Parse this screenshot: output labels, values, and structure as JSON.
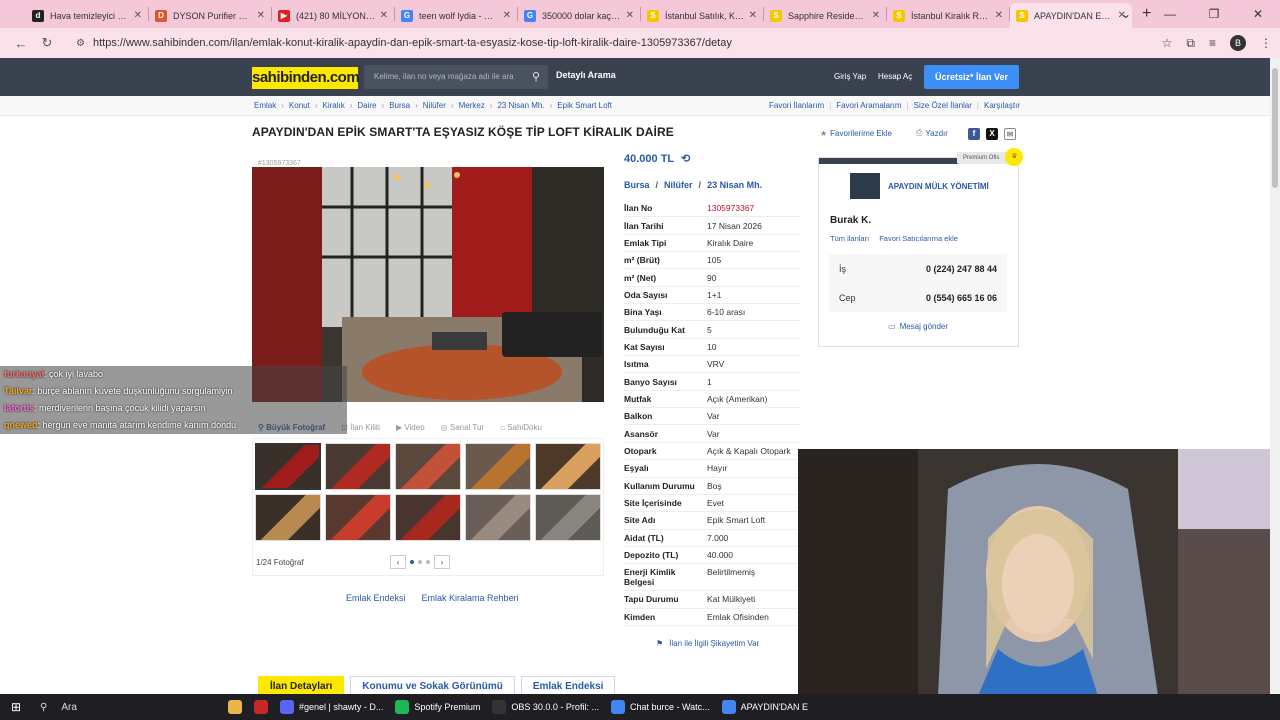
{
  "browser": {
    "tabs": [
      {
        "label": "Hava temizleyici & F",
        "fav": "d",
        "color": "#222"
      },
      {
        "label": "DYSON Purifier Hot+",
        "fav": "D",
        "color": "#e2542e"
      },
      {
        "label": "(421) 80 MİLYON TL'Y",
        "fav": "▶",
        "color": "#e02020"
      },
      {
        "label": "teen wolf lydia - Goo",
        "fav": "G",
        "color": "#4285f4"
      },
      {
        "label": "350000 dolar kaç tl -",
        "fav": "G",
        "color": "#4285f4"
      },
      {
        "label": "İstanbul Satılık, Kiral",
        "fav": "S",
        "color": "#f3c800"
      },
      {
        "label": "Sapphire Residence F",
        "fav": "S",
        "color": "#f3c800"
      },
      {
        "label": "İstanbul Kiralık Rezid",
        "fav": "S",
        "color": "#f3c800"
      },
      {
        "label": "APAYDIN'DAN EPİK",
        "fav": "S",
        "color": "#f3c800"
      }
    ],
    "url": "https://www.sahibinden.com/ilan/emlak-konut-kiralik-apaydin-dan-epik-smart-ta-esyasiz-kose-tip-loft-kiralik-daire-1305973367/detay",
    "avatar": "B"
  },
  "header": {
    "logo": "sahibinden.com",
    "search_placeholder": "Kelime, ilan no veya mağaza adı ile ara",
    "detailed_search": "Detaylı Arama",
    "login": "Giriş Yap",
    "register": "Hesap Aç",
    "post_ad": "Ücretsiz* İlan Ver"
  },
  "breadcrumb": [
    "Emlak",
    "Konut",
    "Kiralık",
    "Daire",
    "Bursa",
    "Nilüfer",
    "Merkez",
    "23 Nisan Mh.",
    "Epik Smart Loft"
  ],
  "breadcrumb_right": [
    "Favori İlanlarım",
    "Favori Aramalarım",
    "Size Özel İlanlar",
    "Karşılaştır"
  ],
  "listing": {
    "title": "APAYDIN'DAN EPİK SMART'TA EŞYASIZ KÖŞE TİP LOFT KİRALIK DAİRE",
    "add_favorite": "Favorilerime Ekle",
    "print": "Yazdır",
    "ad_no_small": "#1305973367",
    "price": "40.000 TL",
    "location": [
      "Bursa",
      "Nilüfer",
      "23 Nisan Mh."
    ],
    "photo_controls": [
      "Büyük Fotoğraf",
      "İlan Kiliti",
      "Video",
      "Sanal Tur",
      "SahiDoku"
    ],
    "photo_count": "1/24 Fotoğraf",
    "below_links": [
      "Emlak Endeksi",
      "Emlak Kiralama Rehberi"
    ],
    "complain": "İlan ile İlgili Şikayetim Var",
    "details": [
      {
        "k": "İlan No",
        "v": "1305973367"
      },
      {
        "k": "İlan Tarihi",
        "v": "17 Nisan 2026"
      },
      {
        "k": "Emlak Tipi",
        "v": "Kiralık Daire"
      },
      {
        "k": "m² (Brüt)",
        "v": "105"
      },
      {
        "k": "m² (Net)",
        "v": "90"
      },
      {
        "k": "Oda Sayısı",
        "v": "1+1"
      },
      {
        "k": "Bina Yaşı",
        "v": "6-10 arası"
      },
      {
        "k": "Bulunduğu Kat",
        "v": "5"
      },
      {
        "k": "Kat Sayısı",
        "v": "10"
      },
      {
        "k": "Isıtma",
        "v": "VRV"
      },
      {
        "k": "Banyo Sayısı",
        "v": "1"
      },
      {
        "k": "Mutfak",
        "v": "Açık (Amerikan)"
      },
      {
        "k": "Balkon",
        "v": "Var"
      },
      {
        "k": "Asansör",
        "v": "Var"
      },
      {
        "k": "Otopark",
        "v": "Açık & Kapalı Otopark"
      },
      {
        "k": "Eşyalı",
        "v": "Hayır"
      },
      {
        "k": "Kullanım Durumu",
        "v": "Boş"
      },
      {
        "k": "Site İçerisinde",
        "v": "Evet"
      },
      {
        "k": "Site Adı",
        "v": "Epik Smart Loft"
      },
      {
        "k": "Aidat (TL)",
        "v": "7.000"
      },
      {
        "k": "Depozito (TL)",
        "v": "40.000"
      },
      {
        "k": "Enerji Kimlik Belgesi",
        "v": "Belirtilmemiş"
      },
      {
        "k": "Tapu Durumu",
        "v": "Kat Mülkiyeti"
      },
      {
        "k": "Kimden",
        "v": "Emlak Ofisinden"
      }
    ]
  },
  "seller": {
    "premium": "Premium Ofis",
    "store": "APAYDIN MÜLK YÖNETİMİ",
    "name": "Burak K.",
    "links": [
      "Tüm ilanları",
      "Favori Satıcılarıma ekle"
    ],
    "phones": [
      {
        "label": "İş",
        "number": "0 (224) 247 88 44"
      },
      {
        "label": "Cep",
        "number": "0 (554) 665 16 06"
      }
    ],
    "message": "Mesaj gönder"
  },
  "bottom_tabs": [
    "İlan Detayları",
    "Konumu ve Sokak Görünümü",
    "Emlak Endeksi"
  ],
  "chat": [
    {
      "user": "furkanyal",
      "msg": ": çok iyi lavabo",
      "color": "#ff6b6b"
    },
    {
      "user": "Tailvar",
      "msg": ": burçe ablanın kuvete duşkunluğunu sorgulamiyin",
      "color": "#f5a623"
    },
    {
      "user": "lafortis",
      "msg": ": merdivenlerin başına çocuk kilidi yaparsın",
      "color": "#ff6bd6"
    },
    {
      "user": "qnewed",
      "msg": ": hergun eve manita atarım kendime kanım dondu",
      "color": "#f5a623"
    }
  ],
  "taskbar": {
    "search": "Ara",
    "apps": [
      {
        "label": "#genel | shawty - D...",
        "color": "#5865f2"
      },
      {
        "label": "Spotify Premium",
        "color": "#1db954"
      },
      {
        "label": "OBS 30.0.0 - Profil: ...",
        "color": "#333"
      },
      {
        "label": "Chat burce - Watc...",
        "color": "#4285f4"
      },
      {
        "label": "APAYDIN'DAN E",
        "color": "#4285f4"
      }
    ]
  }
}
